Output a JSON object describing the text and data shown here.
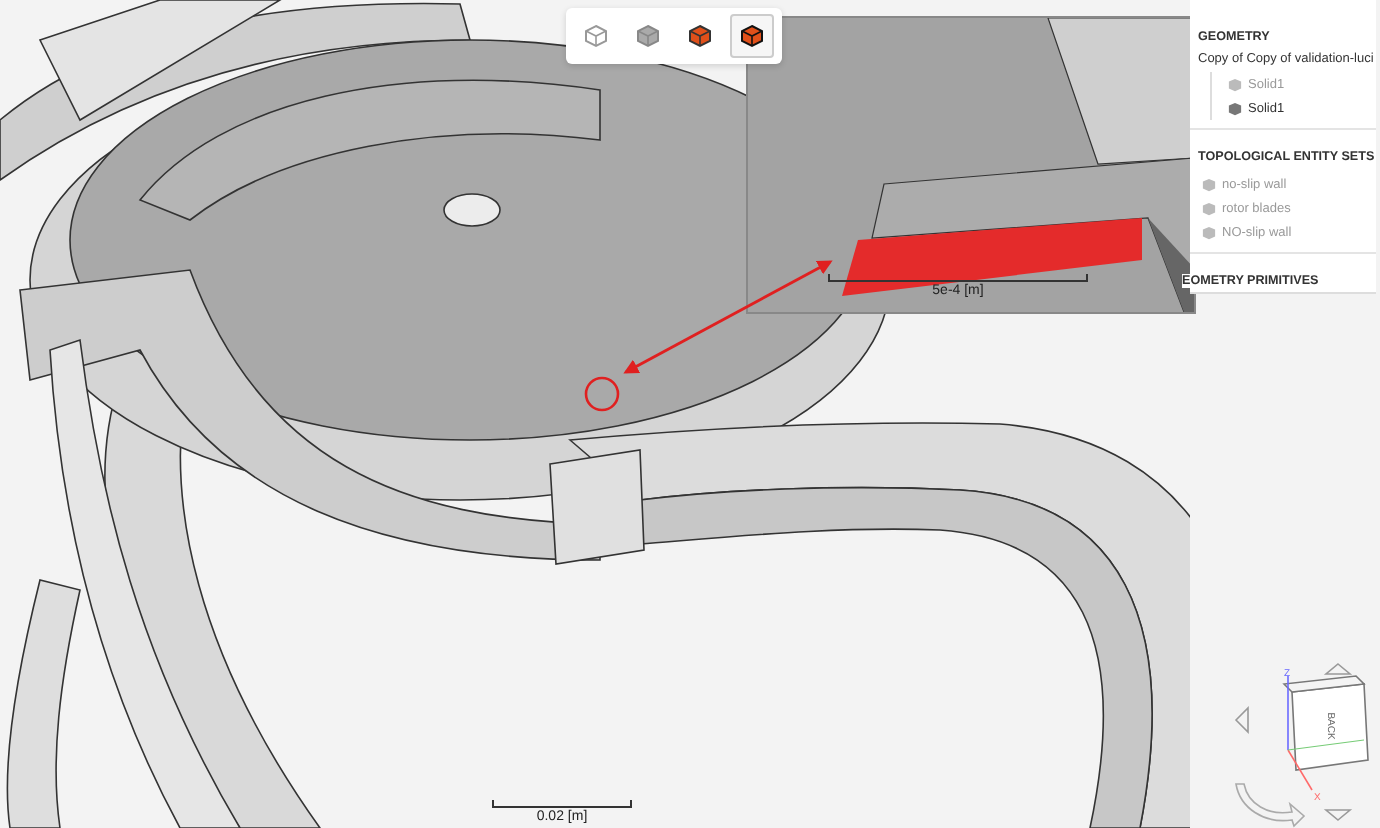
{
  "toolbar": {
    "buttons": [
      {
        "kind": "outline",
        "selected": false
      },
      {
        "kind": "solid",
        "selected": false
      },
      {
        "kind": "faces",
        "selected": false
      },
      {
        "kind": "edges",
        "selected": true
      }
    ]
  },
  "inset": {
    "scale_label": "5e-4 [m]"
  },
  "scale_bar": {
    "label": "0.02 [m]"
  },
  "view_cube": {
    "face_labels": [
      "BACK"
    ],
    "axes": [
      "Z",
      "X"
    ]
  },
  "sidebar": {
    "sections": [
      {
        "title": "GEOMETRY",
        "items": [
          {
            "label": "Copy of Copy of validation-luci",
            "dimmed": false,
            "children": [
              {
                "label": "Solid1",
                "dimmed": true
              },
              {
                "label": "Solid1",
                "dimmed": false
              }
            ]
          }
        ]
      },
      {
        "title": "TOPOLOGICAL ENTITY SETS",
        "items": [
          {
            "label": "no-slip wall",
            "dimmed": true
          },
          {
            "label": "rotor blades",
            "dimmed": true
          },
          {
            "label": "NO-slip wall",
            "dimmed": true
          }
        ]
      },
      {
        "title": "EOMETRY PRIMITIVES"
      }
    ]
  }
}
